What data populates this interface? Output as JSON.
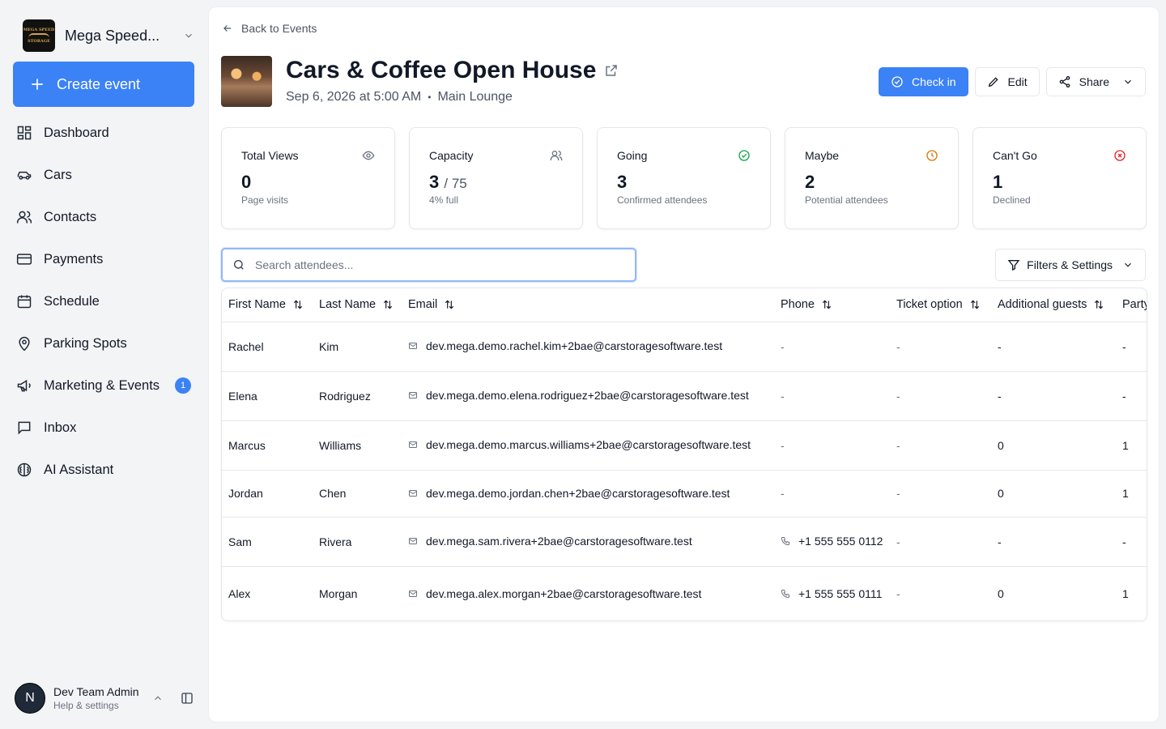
{
  "sidebar": {
    "org_name": "Mega Speed...",
    "org_logo_text": "MEGA SPEED STORAGE",
    "create_label": "Create event",
    "items": [
      {
        "label": "Dashboard",
        "icon": "dashboard-icon"
      },
      {
        "label": "Cars",
        "icon": "car-icon"
      },
      {
        "label": "Contacts",
        "icon": "contacts-icon"
      },
      {
        "label": "Payments",
        "icon": "credit-card-icon"
      },
      {
        "label": "Schedule",
        "icon": "calendar-icon"
      },
      {
        "label": "Parking Spots",
        "icon": "map-pin-icon"
      },
      {
        "label": "Marketing & Events",
        "icon": "megaphone-icon",
        "badge": "1"
      },
      {
        "label": "Inbox",
        "icon": "inbox-icon"
      },
      {
        "label": "AI Assistant",
        "icon": "brain-icon"
      }
    ],
    "user": {
      "initial": "N",
      "name": "Dev Team Admin",
      "sub": "Help & settings"
    }
  },
  "header": {
    "back_label": "Back to Events",
    "title": "Cars & Coffee Open House",
    "date": "Sep 6, 2026 at 5:00 AM",
    "separator": "•",
    "location": "Main Lounge",
    "check_in_label": "Check in",
    "edit_label": "Edit",
    "share_label": "Share"
  },
  "stats": [
    {
      "label": "Total Views",
      "value": "0",
      "sub": "Page visits",
      "icon": "eye-icon",
      "color": "#6b7280"
    },
    {
      "label": "Capacity",
      "value": "3",
      "of": "/ 75",
      "sub": "4% full",
      "icon": "users-icon",
      "color": "#6b7280"
    },
    {
      "label": "Going",
      "value": "3",
      "sub": "Confirmed attendees",
      "icon": "check-circle-icon",
      "color": "#16a34a"
    },
    {
      "label": "Maybe",
      "value": "2",
      "sub": "Potential attendees",
      "icon": "clock-icon",
      "color": "#d97706"
    },
    {
      "label": "Can't Go",
      "value": "1",
      "sub": "Declined",
      "icon": "x-circle-icon",
      "color": "#dc2626"
    }
  ],
  "search": {
    "placeholder": "Search attendees..."
  },
  "filters_label": "Filters & Settings",
  "table": {
    "columns": [
      "First Name",
      "Last Name",
      "Email",
      "Phone",
      "Ticket option",
      "Additional guests",
      "Party size"
    ],
    "rows": [
      {
        "first": "Rachel",
        "last": "Kim",
        "email": "dev.mega.demo.rachel.kim+2bae@carstoragesoftware.test",
        "phone": "-",
        "ticket": "-",
        "guests": "-",
        "party": "-"
      },
      {
        "first": "Elena",
        "last": "Rodriguez",
        "email": "dev.mega.demo.elena.rodriguez+2bae@carstoragesoftware.test",
        "phone": "-",
        "ticket": "-",
        "guests": "-",
        "party": "-"
      },
      {
        "first": "Marcus",
        "last": "Williams",
        "email": "dev.mega.demo.marcus.williams+2bae@carstoragesoftware.test",
        "phone": "-",
        "ticket": "-",
        "guests": "0",
        "party": "1"
      },
      {
        "first": "Jordan",
        "last": "Chen",
        "email": "dev.mega.demo.jordan.chen+2bae@carstoragesoftware.test",
        "phone": "-",
        "ticket": "-",
        "guests": "0",
        "party": "1"
      },
      {
        "first": "Sam",
        "last": "Rivera",
        "email": "dev.mega.sam.rivera+2bae@carstoragesoftware.test",
        "phone": "+1 555 555 0112",
        "ticket": "-",
        "guests": "-",
        "party": "-"
      },
      {
        "first": "Alex",
        "last": "Morgan",
        "email": "dev.mega.alex.morgan+2bae@carstoragesoftware.test",
        "phone": "+1 555 555 0111",
        "ticket": "-",
        "guests": "0",
        "party": "1"
      }
    ]
  }
}
